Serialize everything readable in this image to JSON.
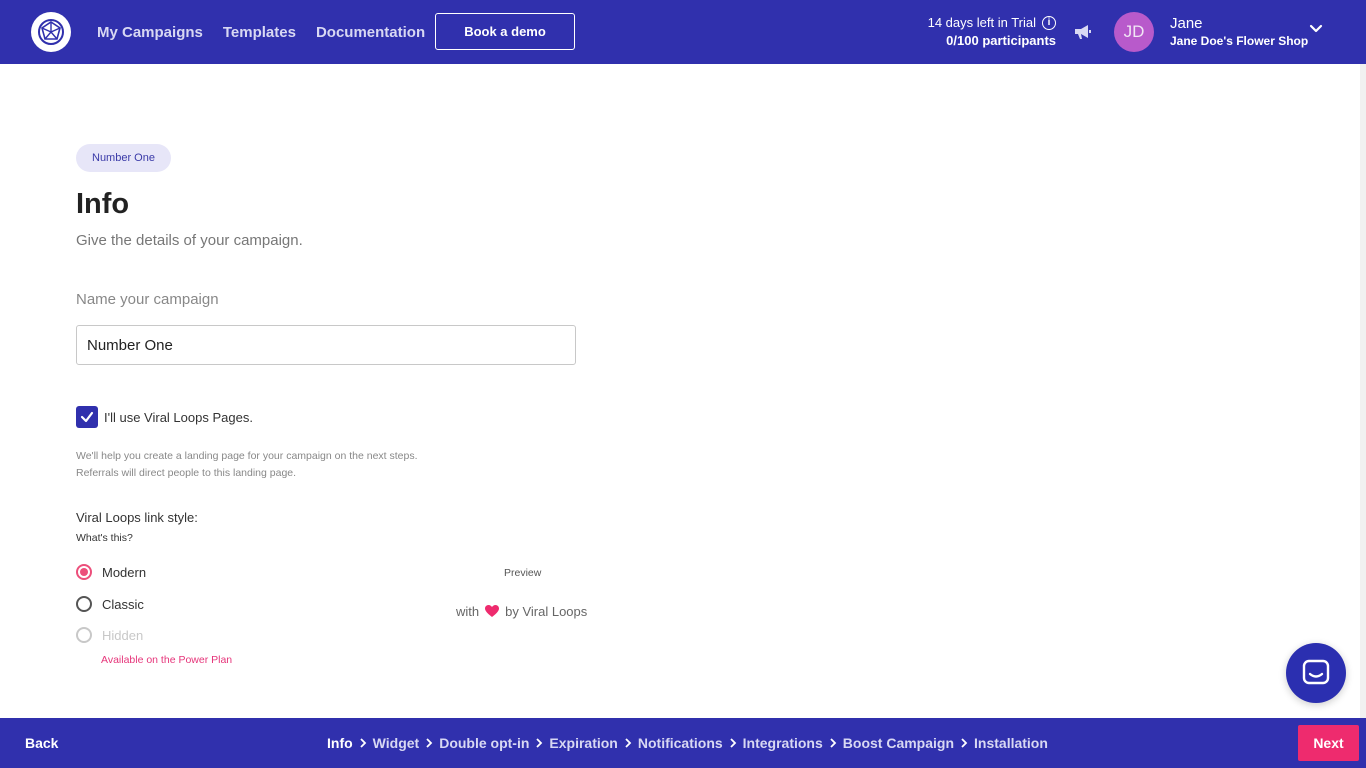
{
  "header": {
    "nav": [
      "My Campaigns",
      "Templates",
      "Documentation"
    ],
    "demo_label": "Book a demo",
    "trial_text": "14 days left in Trial",
    "participants": "0/100 participants",
    "avatar_initials": "JD",
    "user_name": "Jane",
    "user_shop": "Jane Doe's Flower Shop"
  },
  "main": {
    "tag": "Number One",
    "title": "Info",
    "subtitle": "Give the details of your campaign.",
    "name_label": "Name your campaign",
    "name_value": "Number One",
    "checkbox_label": "I'll use Viral Loops Pages.",
    "checkbox_checked": true,
    "helper_line1": "We'll help you create a landing page for your campaign on the next steps.",
    "helper_line2": "Referrals will direct people to this landing page.",
    "link_style_label": "Viral Loops link style:",
    "whats_this": "What's this?",
    "radio_options": [
      "Modern",
      "Classic",
      "Hidden"
    ],
    "selected_option": "Modern",
    "power_plan_note": "Available on the Power Plan",
    "preview_label": "Preview",
    "preview_with": "with",
    "preview_by": "by Viral Loops"
  },
  "footer": {
    "back_label": "Back",
    "steps": [
      "Info",
      "Widget",
      "Double opt-in",
      "Expiration",
      "Notifications",
      "Integrations",
      "Boost Campaign",
      "Installation"
    ],
    "active_step": "Info",
    "next_label": "Next"
  },
  "colors": {
    "brand": "#3030ad",
    "accent": "#ee2b6e",
    "radio_selected": "#ec4f7b"
  }
}
